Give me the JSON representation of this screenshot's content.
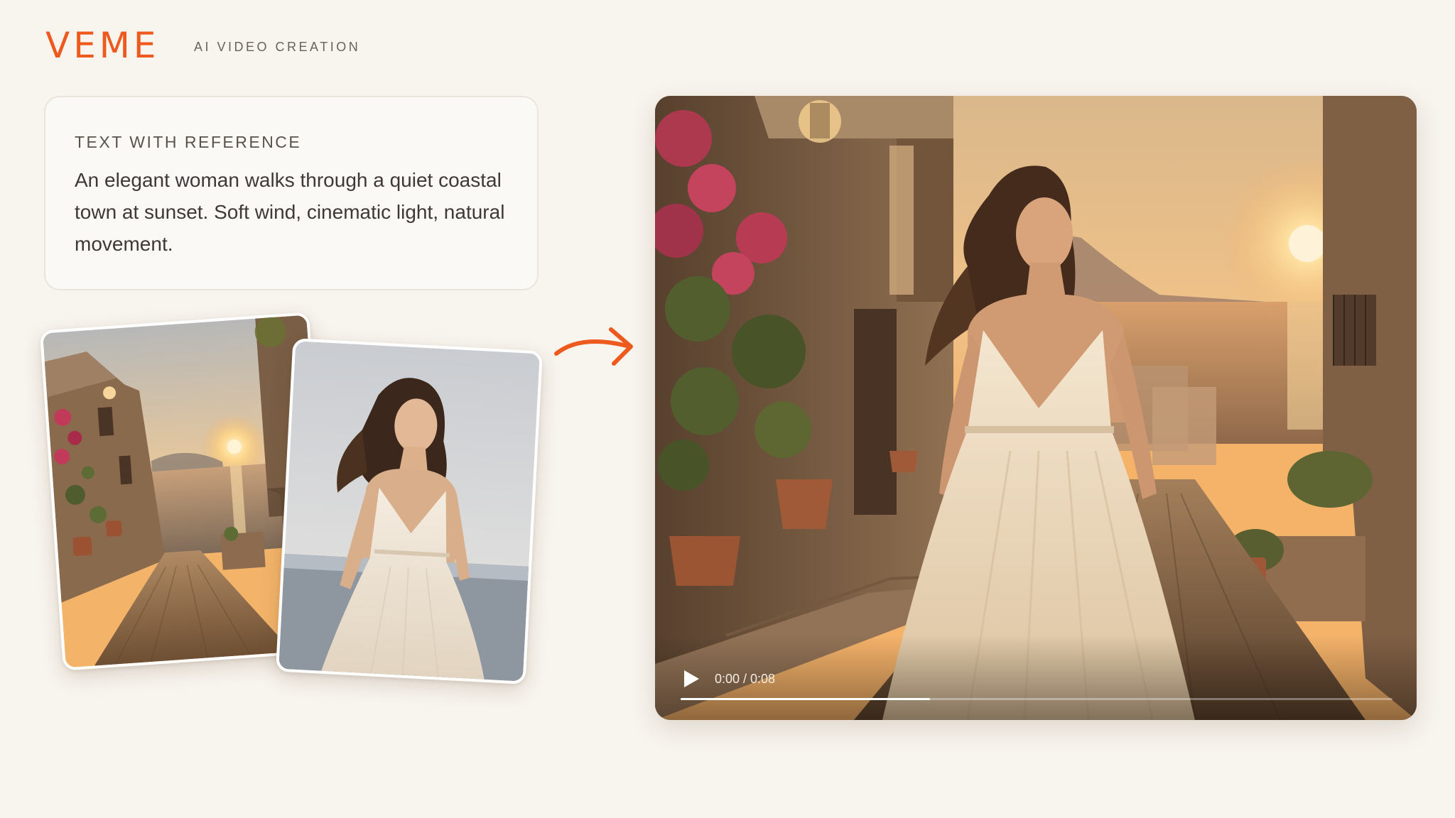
{
  "header": {
    "logo_text": "VEME",
    "tagline": "AI VIDEO CREATION"
  },
  "prompt_card": {
    "heading": "TEXT WITH REFERENCE",
    "body": "An elegant woman walks through a quiet coastal town at sunset. Soft wind, cinematic light, natural movement."
  },
  "reference_images": [
    {
      "subject": "coastal-town-street-at-sunset"
    },
    {
      "subject": "woman-in-white-dress"
    }
  ],
  "video_player": {
    "time_display": "0:00 / 0:08",
    "progress_fraction": 0.35,
    "subject": "woman-walking-coastal-town-sunset"
  },
  "icons": {
    "play": "play-icon",
    "arrow": "arrow-right-icon"
  },
  "colors": {
    "brand": "#ee5a1e",
    "background": "#f8f4ee",
    "card_border": "#ebe4dc",
    "text_primary": "#3e3935",
    "text_secondary": "#6b625a"
  }
}
